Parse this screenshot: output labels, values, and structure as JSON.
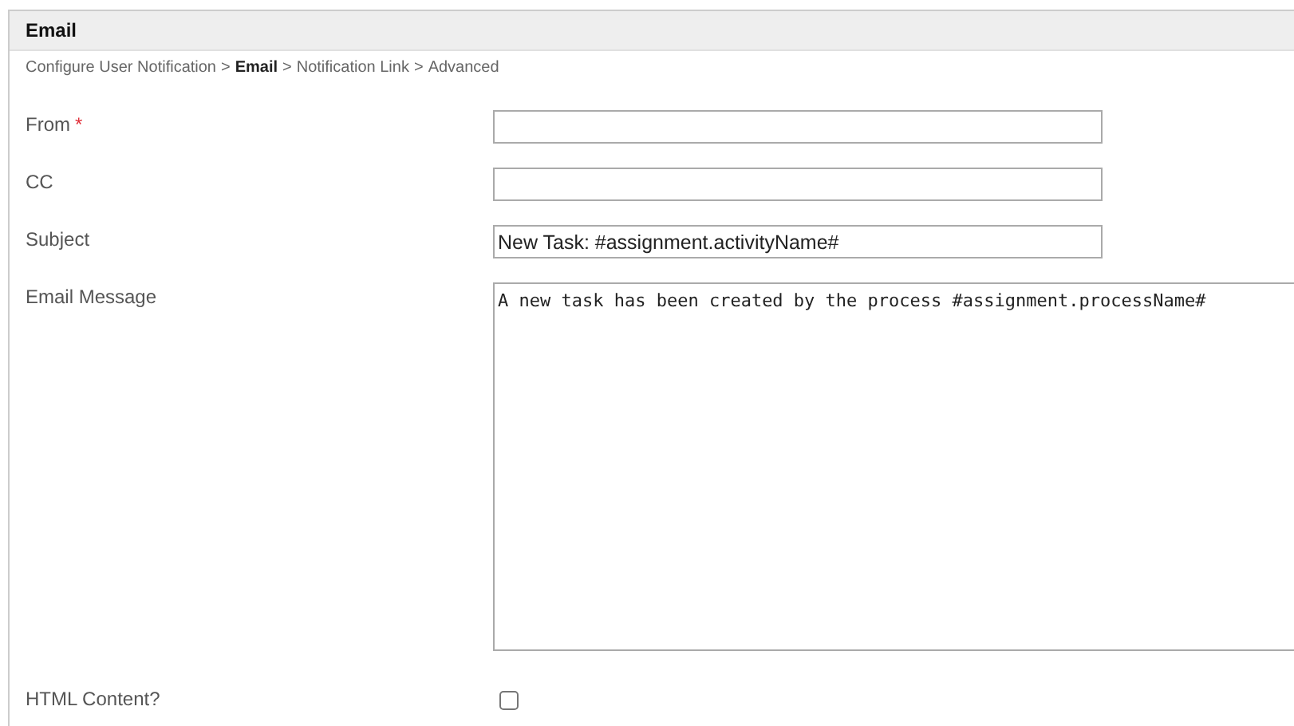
{
  "panel": {
    "title": "Email"
  },
  "breadcrumb": [
    {
      "kind": "link",
      "text": "Configure User Notification",
      "current": false
    },
    {
      "kind": "separator",
      "text": ">"
    },
    {
      "kind": "link",
      "text": "Email",
      "current": true
    },
    {
      "kind": "separator",
      "text": ">"
    },
    {
      "kind": "link",
      "text": "Notification Link",
      "current": false
    },
    {
      "kind": "separator",
      "text": ">"
    },
    {
      "kind": "link",
      "text": "Advanced",
      "current": false
    }
  ],
  "fields": [
    {
      "kind": "text",
      "label": "From",
      "required_mark": "*"
    },
    {
      "kind": "text",
      "label": "CC"
    },
    {
      "kind": "text",
      "label": "Subject",
      "value": "New Task: #assignment.activityName#"
    },
    {
      "kind": "textarea",
      "label": "Email Message",
      "value": "A new task has been created by the process #assignment.processName#"
    },
    {
      "kind": "checkbox",
      "label": "HTML Content?",
      "checked": false
    }
  ]
}
